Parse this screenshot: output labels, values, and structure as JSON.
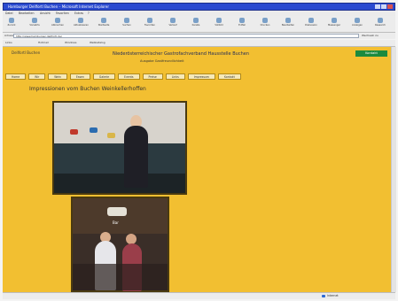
{
  "browser": {
    "window_title": "Hamburger Dellfortl Buchen – Microsoft Internet Explorer",
    "menu": [
      "Datei",
      "Bearbeiten",
      "Ansicht",
      "Favoriten",
      "Extras",
      "?"
    ],
    "toolbar": [
      {
        "label": "Zurück",
        "icon": "back-arrow-icon"
      },
      {
        "label": "Vorwärts",
        "icon": "forward-arrow-icon"
      },
      {
        "label": "Abbrechen",
        "icon": "stop-icon"
      },
      {
        "label": "Aktualisieren",
        "icon": "refresh-icon"
      },
      {
        "label": "Startseite",
        "icon": "home-icon"
      },
      {
        "label": "Suchen",
        "icon": "search-icon"
      },
      {
        "label": "Favoriten",
        "icon": "star-icon"
      },
      {
        "label": "Verlauf",
        "icon": "history-icon"
      },
      {
        "label": "Kanäle",
        "icon": "channels-icon"
      },
      {
        "label": "Vollbild",
        "icon": "fullscreen-icon"
      },
      {
        "label": "E-Mail",
        "icon": "mail-icon"
      },
      {
        "label": "Drucken",
        "icon": "print-icon"
      },
      {
        "label": "Bearbeiten",
        "icon": "edit-icon"
      },
      {
        "label": "Diskussion",
        "icon": "discussion-icon"
      },
      {
        "label": "Messenger",
        "icon": "messenger-icon"
      },
      {
        "label": "Anzeigen",
        "icon": "view-icon"
      },
      {
        "label": "Research",
        "icon": "research-icon"
      }
    ],
    "address_label": "Adresse",
    "address_value": "http://www.hamburger-dellfortl.de/",
    "go_label": "Wechseln zu",
    "links": [
      "Links",
      "Hotmail",
      "Windows",
      "Webkatalog"
    ],
    "status_zone": "Internet"
  },
  "page": {
    "logo_text": "Dellfortl Buchen",
    "title": "Niederösterreichischer Gastrofachverband Hausstelle Buchen",
    "subtitle": "Ausgabe Gastfreundlichkeit",
    "badge": "Kontakt",
    "nav": [
      "Home",
      "Wir",
      "Wein",
      "Essen",
      "Galerie",
      "Events",
      "Preise",
      "Links",
      "Impressum",
      "Kontakt"
    ],
    "heading": "Impressionen vom Buchen Weinkellerhoffen",
    "photo2_sign": "Bar"
  },
  "colors": {
    "page_bg": "#f2bf31",
    "titlebar": "#2a4ad0",
    "badge": "#1b8a3e"
  }
}
